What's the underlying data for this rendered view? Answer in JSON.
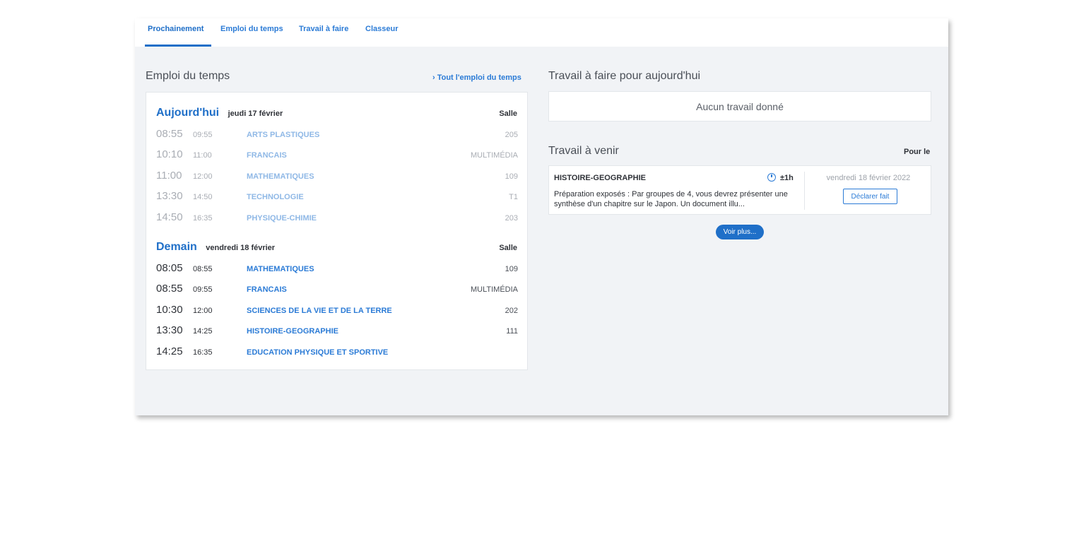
{
  "tabs": [
    {
      "label": "Prochainement"
    },
    {
      "label": "Emploi du temps"
    },
    {
      "label": "Travail à faire"
    },
    {
      "label": "Classeur"
    }
  ],
  "schedule": {
    "title": "Emploi du temps",
    "link_all": "› Tout l'emploi du temps",
    "today": {
      "name": "Aujourd'hui",
      "date": "jeudi 17 février",
      "room_header": "Salle",
      "rows": [
        {
          "start": "08:55",
          "end": "09:55",
          "subject": "ARTS PLASTIQUES",
          "room": "205"
        },
        {
          "start": "10:10",
          "end": "11:00",
          "subject": "FRANCAIS",
          "room": "MULTIMÉDIA"
        },
        {
          "start": "11:00",
          "end": "12:00",
          "subject": "MATHEMATIQUES",
          "room": "109"
        },
        {
          "start": "13:30",
          "end": "14:50",
          "subject": "TECHNOLOGIE",
          "room": "T1"
        },
        {
          "start": "14:50",
          "end": "16:35",
          "subject": "PHYSIQUE-CHIMIE",
          "room": "203"
        }
      ]
    },
    "tomorrow": {
      "name": "Demain",
      "date": "vendredi 18 février",
      "room_header": "Salle",
      "rows": [
        {
          "start": "08:05",
          "end": "08:55",
          "subject": "MATHEMATIQUES",
          "room": "109"
        },
        {
          "start": "08:55",
          "end": "09:55",
          "subject": "FRANCAIS",
          "room": "MULTIMÉDIA"
        },
        {
          "start": "10:30",
          "end": "12:00",
          "subject": "SCIENCES DE LA VIE ET DE LA TERRE",
          "room": "202"
        },
        {
          "start": "13:30",
          "end": "14:25",
          "subject": "HISTOIRE-GEOGRAPHIE",
          "room": "111"
        },
        {
          "start": "14:25",
          "end": "16:35",
          "subject": "EDUCATION PHYSIQUE ET SPORTIVE",
          "room": ""
        }
      ]
    }
  },
  "homework_today": {
    "title": "Travail à faire pour aujourd'hui",
    "empty": "Aucun travail donné"
  },
  "homework_upcoming": {
    "title": "Travail à venir",
    "pour_le": "Pour le",
    "item": {
      "subject": "HISTOIRE-GEOGRAPHIE",
      "clock_icon": "clock-icon",
      "duration": "±1h",
      "description": "Préparation exposés : Par groupes de 4, vous devrez présenter une synthèse d'un chapitre sur le Japon. Un document illu...",
      "due": "vendredi 18 février 2022",
      "done_label": "Déclarer fait"
    },
    "more_label": "Voir plus..."
  },
  "colors": {
    "accent": "#1f6fc8",
    "link": "#2b7bd6",
    "background": "#f1f3f6"
  }
}
